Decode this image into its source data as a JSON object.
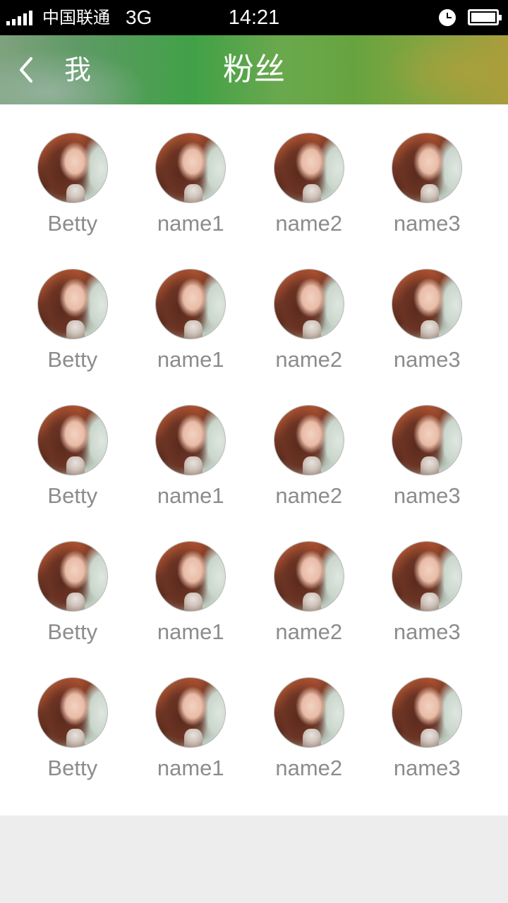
{
  "status_bar": {
    "carrier": "中国联通",
    "network": "3G",
    "time": "14:21",
    "signal_bars": 5
  },
  "nav": {
    "back_label": "我",
    "title": "粉丝"
  },
  "fans": [
    {
      "name": "Betty"
    },
    {
      "name": "name1"
    },
    {
      "name": "name2"
    },
    {
      "name": "name3"
    },
    {
      "name": "Betty"
    },
    {
      "name": "name1"
    },
    {
      "name": "name2"
    },
    {
      "name": "name3"
    },
    {
      "name": "Betty"
    },
    {
      "name": "name1"
    },
    {
      "name": "name2"
    },
    {
      "name": "name3"
    },
    {
      "name": "Betty"
    },
    {
      "name": "name1"
    },
    {
      "name": "name2"
    },
    {
      "name": "name3"
    },
    {
      "name": "Betty"
    },
    {
      "name": "name1"
    },
    {
      "name": "name2"
    },
    {
      "name": "name3"
    }
  ],
  "colors": {
    "nav_green": "#41a147",
    "name_gray": "#8c8c8c",
    "background": "#ededed"
  }
}
